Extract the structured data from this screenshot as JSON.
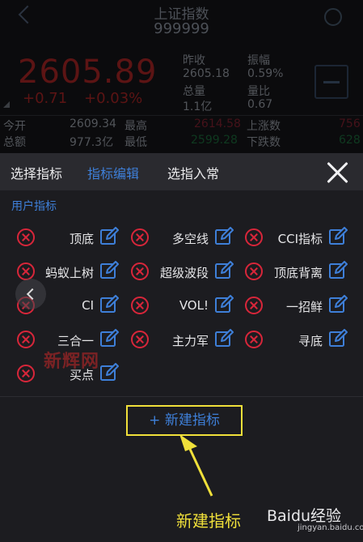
{
  "background": {
    "title": "上证指数",
    "code": "999999",
    "price": "2605.89",
    "change": "+0.71",
    "change_pct": "+0.03%",
    "stats": [
      {
        "label": "昨收",
        "value": "2605.18"
      },
      {
        "label": "振幅",
        "value": "0.59%"
      },
      {
        "label": "总量",
        "value": "1.1亿"
      },
      {
        "label": "量比",
        "value": "0.67"
      }
    ],
    "rows": [
      {
        "l1": "今开",
        "v1": "2609.34",
        "l2": "最高",
        "v2": "2614.58",
        "l3": "上涨数",
        "v3": "756"
      },
      {
        "l1": "总额",
        "v1": "977.3亿",
        "l2": "最低",
        "v2": "2599.28",
        "l3": "下跌数",
        "v3": "628"
      }
    ]
  },
  "panel": {
    "tabs": [
      "选择指标",
      "指标编辑",
      "选指入常"
    ],
    "active_tab": "指标编辑",
    "section_title": "用户指标",
    "indicators": [
      "顶底",
      "多空线",
      "CCI指标",
      "蚂蚁上树",
      "超级波段",
      "顶底背离",
      "CI",
      "VOL!",
      "一招鲜",
      "三合一",
      "主力军",
      "寻底",
      "买点"
    ],
    "new_button": "+ 新建指标"
  },
  "annotation": {
    "caption": "新建指标",
    "watermark": "新辉网",
    "brand": "Baidu经验",
    "brand_url": "jingyan.baidu.com",
    "colors": {
      "highlight": "#f0e03a",
      "accent": "#3e7fd8",
      "delete": "#d8263a"
    }
  }
}
